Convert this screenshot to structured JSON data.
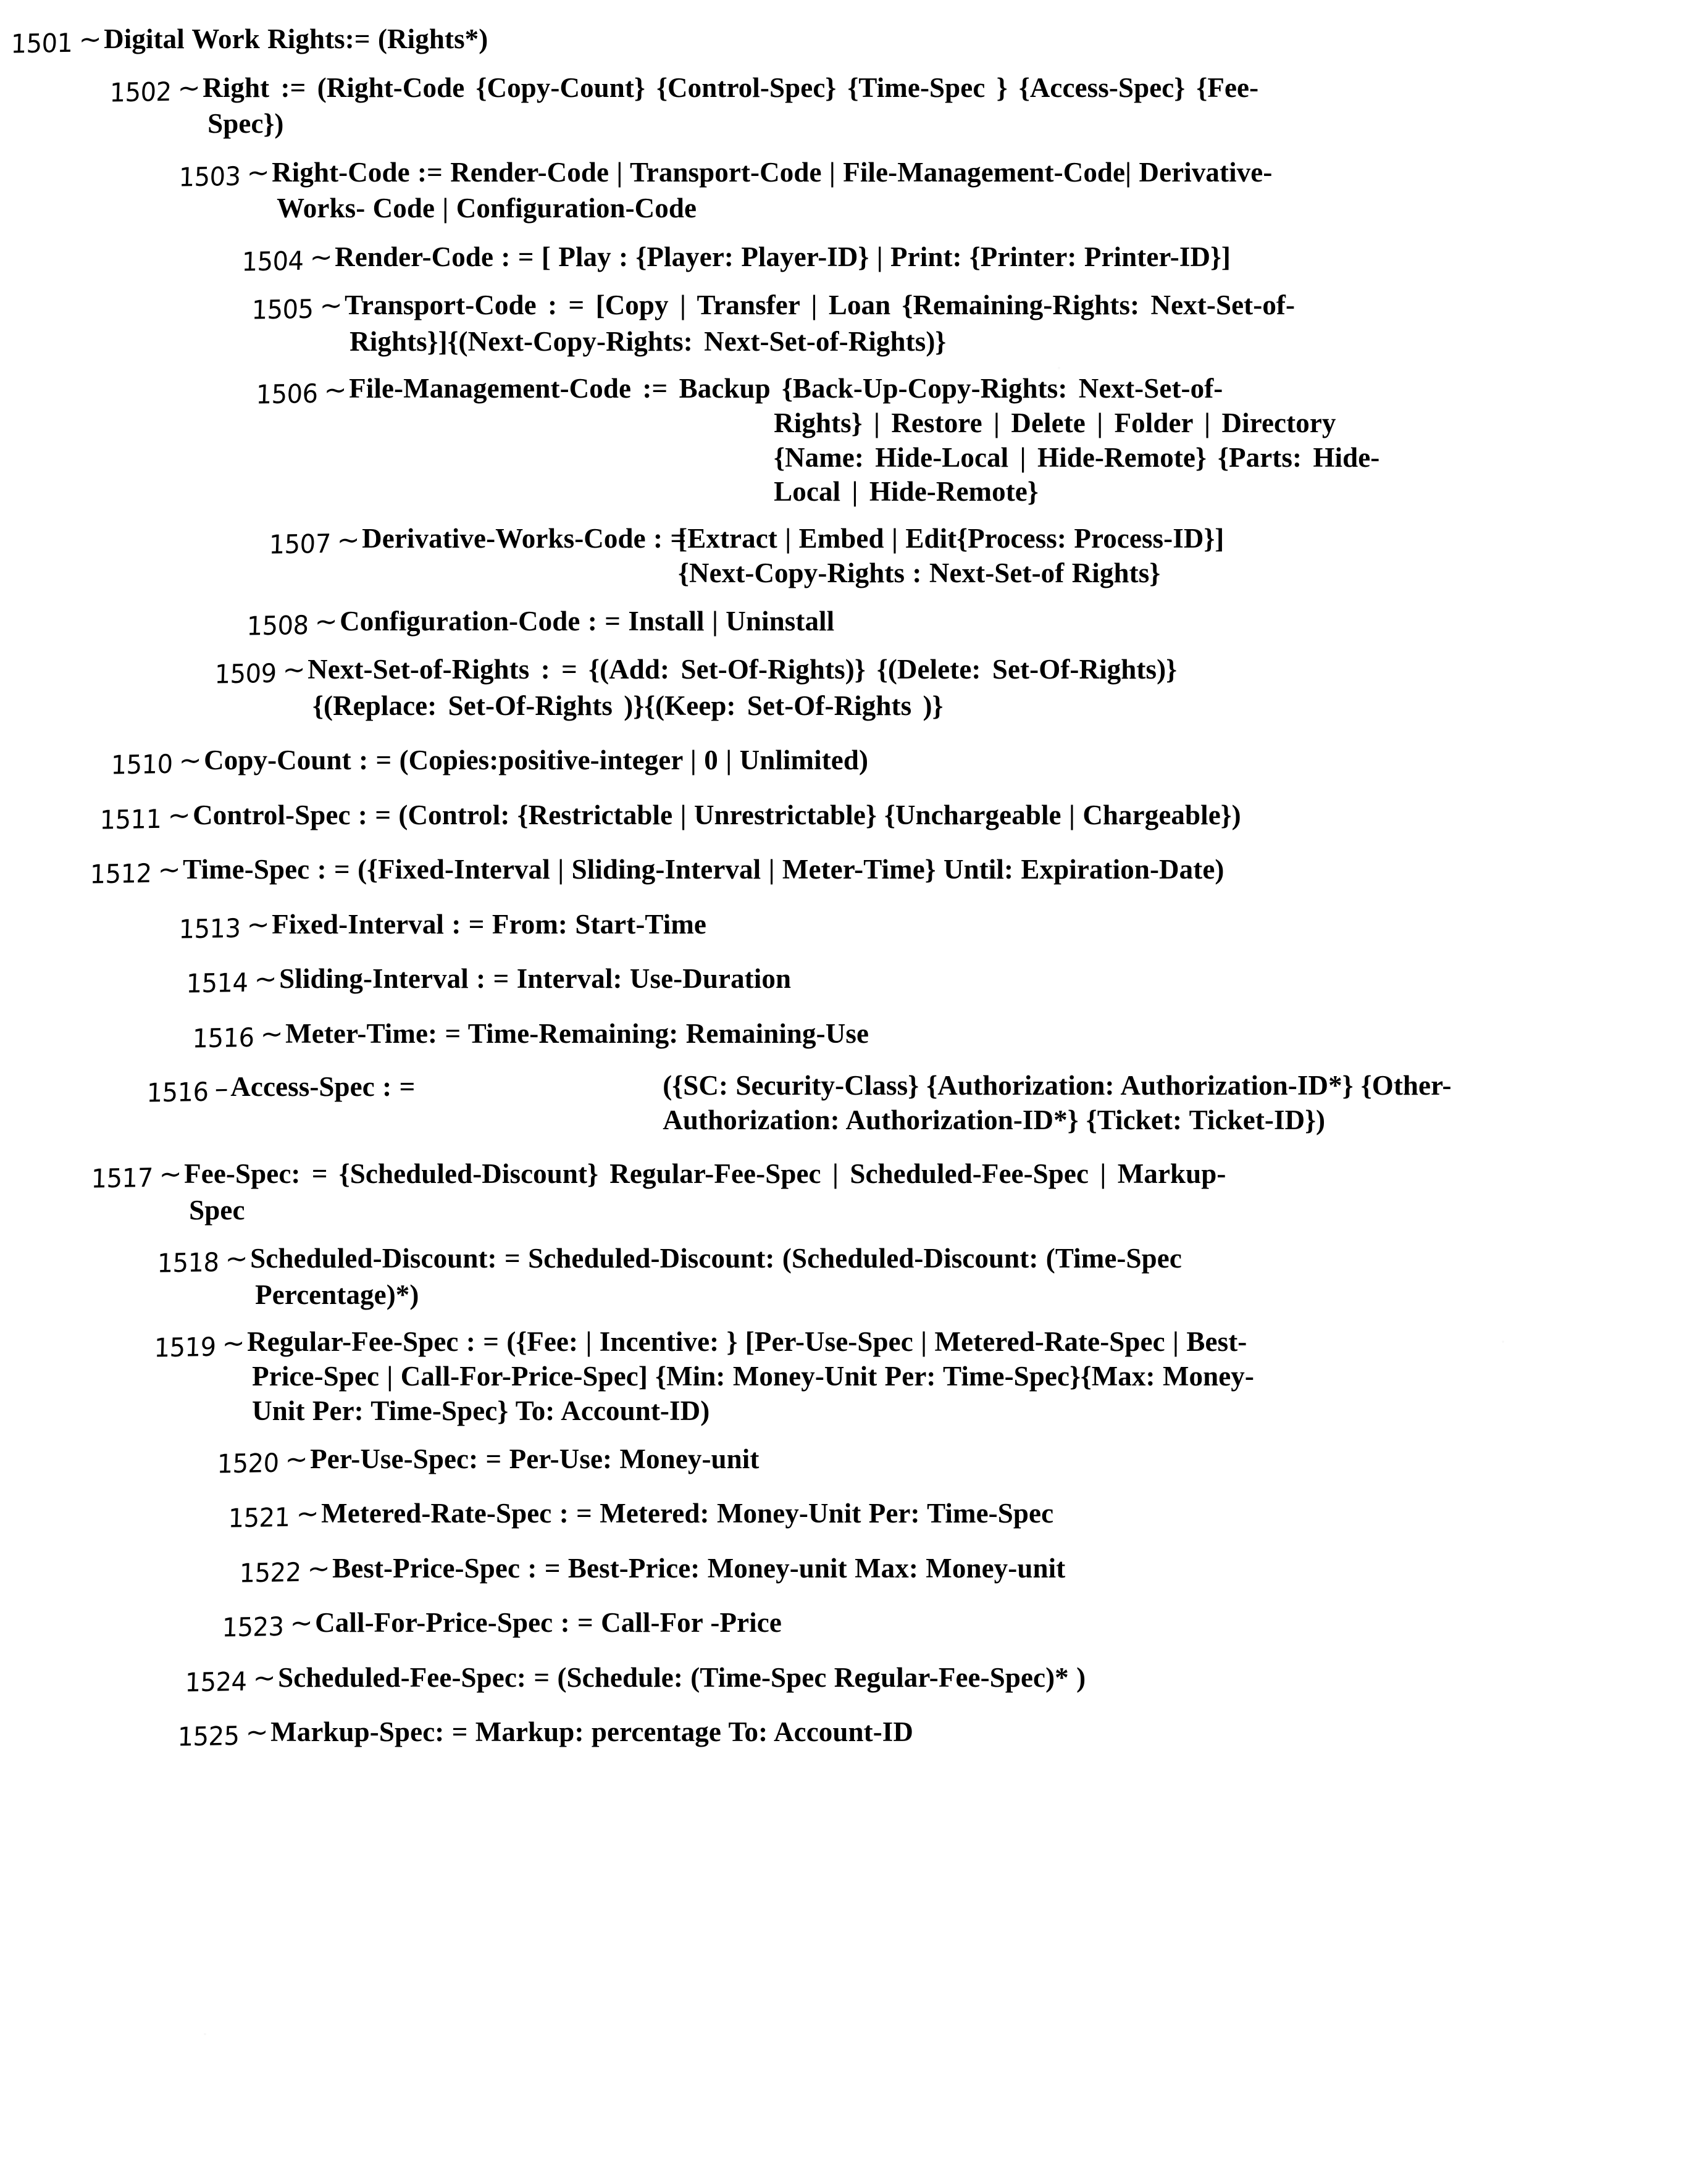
{
  "figure": {
    "kind": "patent-figure-bnf-grammar",
    "title_rule": "Digital Work Rights",
    "ink_color": "#000000",
    "paper_color": "#ffffff"
  },
  "rules": [
    {
      "ref": "1501",
      "leader": "~",
      "lines": [
        "Digital Work Rights:= (Rights*)"
      ]
    },
    {
      "ref": "1502",
      "leader": "~",
      "lines": [
        "Right := (Right-Code {Copy-Count} {Control-Spec} {Time-Spec } {Access-Spec} {Fee-",
        "Spec})"
      ]
    },
    {
      "ref": "1503",
      "leader": "~",
      "lines": [
        "Right-Code := Render-Code | Transport-Code | File-Management-Code| Derivative-",
        "Works- Code | Configuration-Code"
      ]
    },
    {
      "ref": "1504",
      "leader": "~",
      "lines": [
        "Render-Code : = [ Play : {Player: Player-ID} | Print: {Printer: Printer-ID}]"
      ]
    },
    {
      "ref": "1505",
      "leader": "~",
      "lines": [
        "Transport-Code : = [Copy | Transfer | Loan {Remaining-Rights: Next-Set-of-",
        "Rights}]{(Next-Copy-Rights: Next-Set-of-Rights)}"
      ]
    },
    {
      "ref": "1506",
      "leader": "~",
      "lines": [
        "File-Management-Code  :=  Backup {Back-Up-Copy-Rights: Next-Set-of-",
        "Rights} | Restore | Delete | Folder | Directory",
        "{Name: Hide-Local | Hide-Remote} {Parts: Hide-",
        "Local | Hide-Remote}"
      ]
    },
    {
      "ref": "1507",
      "leader": "~",
      "lines": [
        "Derivative-Works-Code : =",
        "[Extract | Embed | Edit{Process: Process-ID}]",
        "{Next-Copy-Rights : Next-Set-of Rights}"
      ]
    },
    {
      "ref": "1508",
      "leader": "~",
      "lines": [
        "Configuration-Code : = Install | Uninstall"
      ]
    },
    {
      "ref": "1509",
      "leader": "~",
      "lines": [
        "Next-Set-of-Rights  : =  {(Add:   Set-Of-Rights)} {(Delete:  Set-Of-Rights)}",
        "{(Replace: Set-Of-Rights )}{(Keep: Set-Of-Rights )}"
      ]
    },
    {
      "ref": "1510",
      "leader": "~",
      "lines": [
        "Copy-Count : = (Copies:positive-integer | 0 | Unlimited)"
      ]
    },
    {
      "ref": "1511",
      "leader": "~",
      "lines": [
        "Control-Spec : = (Control: {Restrictable | Unrestrictable} {Unchargeable | Chargeable})"
      ]
    },
    {
      "ref": "1512",
      "leader": "~",
      "lines": [
        "Time-Spec : = ({Fixed-Interval | Sliding-Interval | Meter-Time} Until: Expiration-Date)"
      ]
    },
    {
      "ref": "1513",
      "leader": "~",
      "lines": [
        "Fixed-Interval : = From: Start-Time"
      ]
    },
    {
      "ref": "1514",
      "leader": "~",
      "lines": [
        "Sliding-Interval : = Interval: Use-Duration"
      ]
    },
    {
      "ref": "1516",
      "leader": "~",
      "lines": [
        "Meter-Time: = Time-Remaining: Remaining-Use"
      ]
    },
    {
      "ref": "1516",
      "leader": "–",
      "lines": [
        "Access-Spec : =",
        "({SC: Security-Class} {Authorization: Authorization-ID*} {Other-",
        "Authorization: Authorization-ID*} {Ticket: Ticket-ID})"
      ]
    },
    {
      "ref": "1517",
      "leader": "~",
      "lines": [
        "Fee-Spec: =  {Scheduled-Discount} Regular-Fee-Spec | Scheduled-Fee-Spec | Markup-",
        "Spec"
      ]
    },
    {
      "ref": "1518",
      "leader": "~",
      "lines": [
        "Scheduled-Discount: = Scheduled-Discount: (Scheduled-Discount: (Time-Spec",
        "Percentage)*)"
      ]
    },
    {
      "ref": "1519",
      "leader": "~",
      "lines": [
        "Regular-Fee-Spec : = ({Fee: | Incentive: } [Per-Use-Spec | Metered-Rate-Spec | Best-",
        "Price-Spec | Call-For-Price-Spec] {Min: Money-Unit Per: Time-Spec}{Max: Money-",
        "Unit Per: Time-Spec} To: Account-ID)"
      ]
    },
    {
      "ref": "1520",
      "leader": "~",
      "lines": [
        "Per-Use-Spec: = Per-Use: Money-unit"
      ]
    },
    {
      "ref": "1521",
      "leader": "~",
      "lines": [
        "Metered-Rate-Spec : = Metered: Money-Unit Per: Time-Spec"
      ]
    },
    {
      "ref": "1522",
      "leader": "~",
      "lines": [
        "Best-Price-Spec : = Best-Price: Money-unit Max: Money-unit"
      ]
    },
    {
      "ref": "1523",
      "leader": "~",
      "lines": [
        "Call-For-Price-Spec : = Call-For -Price"
      ]
    },
    {
      "ref": "1524",
      "leader": "~",
      "lines": [
        "Scheduled-Fee-Spec: = (Schedule: (Time-Spec Regular-Fee-Spec)* )"
      ]
    },
    {
      "ref": "1525",
      "leader": "~",
      "lines": [
        "Markup-Spec: = Markup: percentage To: Account-ID"
      ]
    }
  ]
}
